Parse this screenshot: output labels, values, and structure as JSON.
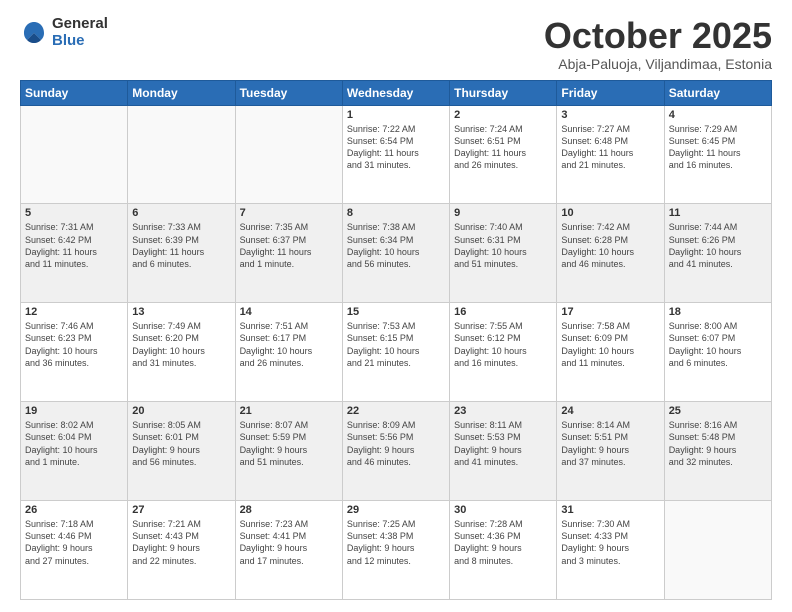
{
  "logo": {
    "general": "General",
    "blue": "Blue"
  },
  "header": {
    "month": "October 2025",
    "location": "Abja-Paluoja, Viljandimaa, Estonia"
  },
  "weekdays": [
    "Sunday",
    "Monday",
    "Tuesday",
    "Wednesday",
    "Thursday",
    "Friday",
    "Saturday"
  ],
  "weeks": [
    [
      {
        "day": "",
        "info": ""
      },
      {
        "day": "",
        "info": ""
      },
      {
        "day": "",
        "info": ""
      },
      {
        "day": "1",
        "info": "Sunrise: 7:22 AM\nSunset: 6:54 PM\nDaylight: 11 hours\nand 31 minutes."
      },
      {
        "day": "2",
        "info": "Sunrise: 7:24 AM\nSunset: 6:51 PM\nDaylight: 11 hours\nand 26 minutes."
      },
      {
        "day": "3",
        "info": "Sunrise: 7:27 AM\nSunset: 6:48 PM\nDaylight: 11 hours\nand 21 minutes."
      },
      {
        "day": "4",
        "info": "Sunrise: 7:29 AM\nSunset: 6:45 PM\nDaylight: 11 hours\nand 16 minutes."
      }
    ],
    [
      {
        "day": "5",
        "info": "Sunrise: 7:31 AM\nSunset: 6:42 PM\nDaylight: 11 hours\nand 11 minutes."
      },
      {
        "day": "6",
        "info": "Sunrise: 7:33 AM\nSunset: 6:39 PM\nDaylight: 11 hours\nand 6 minutes."
      },
      {
        "day": "7",
        "info": "Sunrise: 7:35 AM\nSunset: 6:37 PM\nDaylight: 11 hours\nand 1 minute."
      },
      {
        "day": "8",
        "info": "Sunrise: 7:38 AM\nSunset: 6:34 PM\nDaylight: 10 hours\nand 56 minutes."
      },
      {
        "day": "9",
        "info": "Sunrise: 7:40 AM\nSunset: 6:31 PM\nDaylight: 10 hours\nand 51 minutes."
      },
      {
        "day": "10",
        "info": "Sunrise: 7:42 AM\nSunset: 6:28 PM\nDaylight: 10 hours\nand 46 minutes."
      },
      {
        "day": "11",
        "info": "Sunrise: 7:44 AM\nSunset: 6:26 PM\nDaylight: 10 hours\nand 41 minutes."
      }
    ],
    [
      {
        "day": "12",
        "info": "Sunrise: 7:46 AM\nSunset: 6:23 PM\nDaylight: 10 hours\nand 36 minutes."
      },
      {
        "day": "13",
        "info": "Sunrise: 7:49 AM\nSunset: 6:20 PM\nDaylight: 10 hours\nand 31 minutes."
      },
      {
        "day": "14",
        "info": "Sunrise: 7:51 AM\nSunset: 6:17 PM\nDaylight: 10 hours\nand 26 minutes."
      },
      {
        "day": "15",
        "info": "Sunrise: 7:53 AM\nSunset: 6:15 PM\nDaylight: 10 hours\nand 21 minutes."
      },
      {
        "day": "16",
        "info": "Sunrise: 7:55 AM\nSunset: 6:12 PM\nDaylight: 10 hours\nand 16 minutes."
      },
      {
        "day": "17",
        "info": "Sunrise: 7:58 AM\nSunset: 6:09 PM\nDaylight: 10 hours\nand 11 minutes."
      },
      {
        "day": "18",
        "info": "Sunrise: 8:00 AM\nSunset: 6:07 PM\nDaylight: 10 hours\nand 6 minutes."
      }
    ],
    [
      {
        "day": "19",
        "info": "Sunrise: 8:02 AM\nSunset: 6:04 PM\nDaylight: 10 hours\nand 1 minute."
      },
      {
        "day": "20",
        "info": "Sunrise: 8:05 AM\nSunset: 6:01 PM\nDaylight: 9 hours\nand 56 minutes."
      },
      {
        "day": "21",
        "info": "Sunrise: 8:07 AM\nSunset: 5:59 PM\nDaylight: 9 hours\nand 51 minutes."
      },
      {
        "day": "22",
        "info": "Sunrise: 8:09 AM\nSunset: 5:56 PM\nDaylight: 9 hours\nand 46 minutes."
      },
      {
        "day": "23",
        "info": "Sunrise: 8:11 AM\nSunset: 5:53 PM\nDaylight: 9 hours\nand 41 minutes."
      },
      {
        "day": "24",
        "info": "Sunrise: 8:14 AM\nSunset: 5:51 PM\nDaylight: 9 hours\nand 37 minutes."
      },
      {
        "day": "25",
        "info": "Sunrise: 8:16 AM\nSunset: 5:48 PM\nDaylight: 9 hours\nand 32 minutes."
      }
    ],
    [
      {
        "day": "26",
        "info": "Sunrise: 7:18 AM\nSunset: 4:46 PM\nDaylight: 9 hours\nand 27 minutes."
      },
      {
        "day": "27",
        "info": "Sunrise: 7:21 AM\nSunset: 4:43 PM\nDaylight: 9 hours\nand 22 minutes."
      },
      {
        "day": "28",
        "info": "Sunrise: 7:23 AM\nSunset: 4:41 PM\nDaylight: 9 hours\nand 17 minutes."
      },
      {
        "day": "29",
        "info": "Sunrise: 7:25 AM\nSunset: 4:38 PM\nDaylight: 9 hours\nand 12 minutes."
      },
      {
        "day": "30",
        "info": "Sunrise: 7:28 AM\nSunset: 4:36 PM\nDaylight: 9 hours\nand 8 minutes."
      },
      {
        "day": "31",
        "info": "Sunrise: 7:30 AM\nSunset: 4:33 PM\nDaylight: 9 hours\nand 3 minutes."
      },
      {
        "day": "",
        "info": ""
      }
    ]
  ]
}
